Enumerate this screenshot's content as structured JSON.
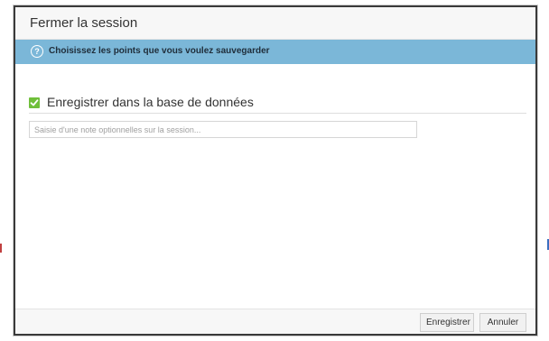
{
  "dialog": {
    "title": "Fermer la session"
  },
  "info_bar": {
    "icon": "question-circle-icon",
    "message": "Choisissez les points que vous voulez sauvegarder"
  },
  "save_option": {
    "checked": true,
    "label": "Enregistrer dans la base de données"
  },
  "note": {
    "value": "",
    "placeholder": "Saisie d'une note optionnelles sur la session..."
  },
  "footer": {
    "save_label": "Enregistrer",
    "cancel_label": "Annuler"
  },
  "colors": {
    "info_bar_bg": "#7bb7d8",
    "checkbox_green": "#6fbf3a"
  }
}
